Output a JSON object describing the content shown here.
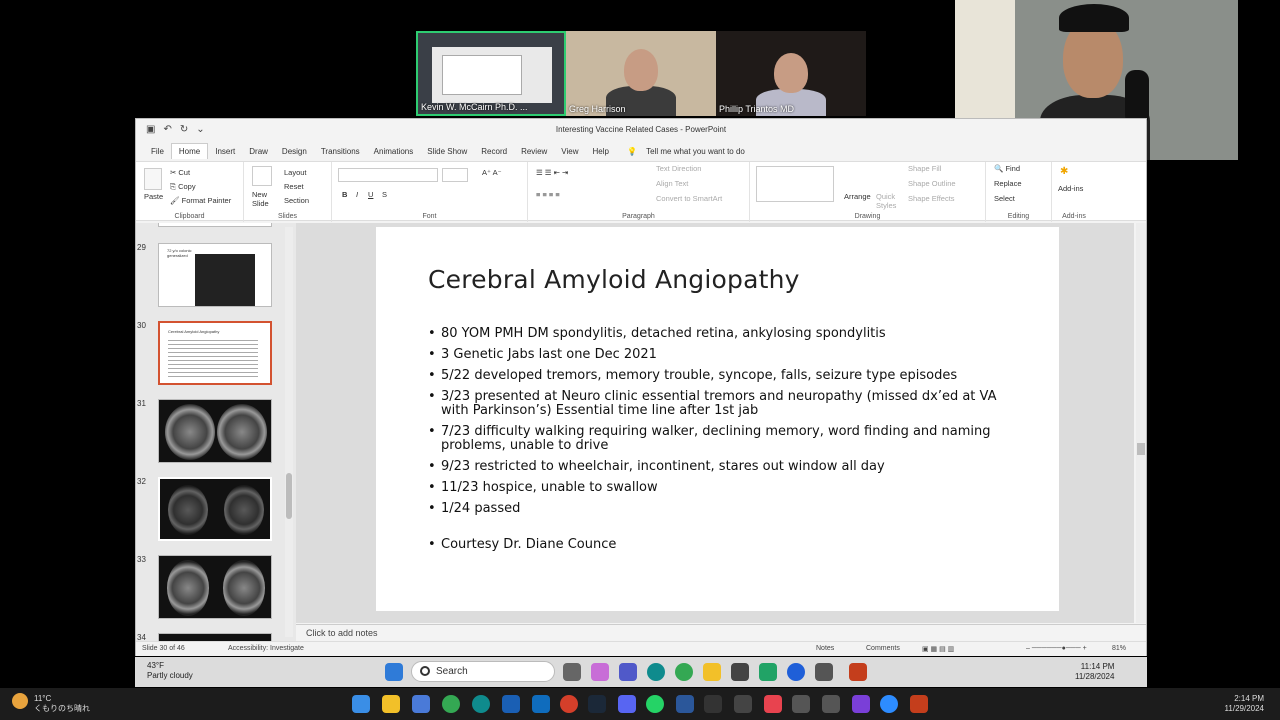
{
  "meeting": {
    "participants": [
      {
        "name": "Kevin W. McCairn Ph.D. ..."
      },
      {
        "name": "Greg Harrison"
      },
      {
        "name": "Phillip Triantos MD"
      }
    ]
  },
  "window": {
    "title": "Interesting Vaccine Related Cases  -  PowerPoint"
  },
  "menu": {
    "tabs": [
      "File",
      "Home",
      "Insert",
      "Draw",
      "Design",
      "Transitions",
      "Animations",
      "Slide Show",
      "Record",
      "Review",
      "View",
      "Help"
    ],
    "active": "Home",
    "tell_me": "Tell me what you want to do"
  },
  "ribbon": {
    "clipboard": {
      "paste": "Paste",
      "cut": "Cut",
      "copy": "Copy",
      "format_painter": "Format Painter",
      "label": "Clipboard"
    },
    "slides": {
      "new_slide": "New Slide",
      "layout": "Layout",
      "reset": "Reset",
      "section": "Section",
      "label": "Slides"
    },
    "font": {
      "label": "Font"
    },
    "paragraph": {
      "text_direction": "Text Direction",
      "align_text": "Align Text",
      "smartart": "Convert to SmartArt",
      "label": "Paragraph"
    },
    "drawing": {
      "arrange": "Arrange",
      "quick_styles": "Quick Styles",
      "shape_fill": "Shape Fill",
      "shape_outline": "Shape Outline",
      "shape_effects": "Shape Effects",
      "label": "Drawing"
    },
    "editing": {
      "find": "Find",
      "replace": "Replace",
      "select": "Select",
      "label": "Editing"
    },
    "addins": {
      "addins": "Add-ins",
      "label": "Add-ins"
    }
  },
  "thumbnails": [
    {
      "num": "29",
      "caption": "72 y/o colonic\ngeneralized"
    },
    {
      "num": "30",
      "caption": "Cerebral Amyloid Angiopathy"
    },
    {
      "num": "31"
    },
    {
      "num": "32"
    },
    {
      "num": "33"
    },
    {
      "num": "34"
    }
  ],
  "slide": {
    "title": "Cerebral Amyloid Angiopathy",
    "bullets": [
      "80 YOM   PMH DM spondylitis, detached retina, ankylosing spondylitis",
      "3 Genetic Jabs last one Dec 2021",
      "5/22 developed tremors, memory trouble, syncope, falls, seizure type episodes",
      "3/23 presented at Neuro clinic essential tremors  and neuropathy (missed dx’ed at VA with Parkinson’s) Essential time line after 1st jab",
      "7/23 difficulty walking requiring walker, declining memory, word finding and naming problems, unable to drive",
      "9/23  restricted to wheelchair, incontinent, stares out window all day",
      "11/23 hospice, unable to swallow",
      "1/24  passed",
      "Courtesy Dr. Diane Counce"
    ]
  },
  "notes_placeholder": "Click to add notes",
  "status": {
    "slide": "Slide 30 of 46",
    "accessibility": "Accessibility: Investigate",
    "notes": "Notes",
    "comments": "Comments",
    "zoom": "81%"
  },
  "inner_taskbar": {
    "weather_temp": "43°F",
    "weather_desc": "Partly cloudy",
    "search": "Search",
    "time": "11:14 PM",
    "date": "11/28/2024"
  },
  "outer_taskbar": {
    "weather_temp": "11°C",
    "weather_desc": "くもりのち晴れ",
    "time": "2:14 PM",
    "date": "11/29/2024"
  },
  "colors": {
    "ppt_accent": "#d35230",
    "active_speaker": "#2ecc71"
  }
}
